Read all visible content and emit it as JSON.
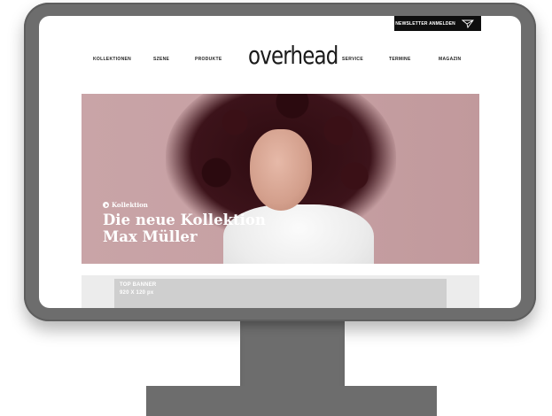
{
  "newsletter": {
    "label": "Newsletter anmelden",
    "icon": "paper-plane-icon"
  },
  "nav": {
    "left_items": [
      "Kollektionen",
      "Szene",
      "Produkte"
    ],
    "right_items": [
      "Service",
      "Termine",
      "Magazin"
    ]
  },
  "logo": {
    "text": "overhead"
  },
  "hero": {
    "tag": "Kollektion",
    "title_line1": "Die neue Kollektion",
    "title_line2": "Max Müller"
  },
  "banner": {
    "label": "TOP BANNER",
    "size": "920 X 120 px"
  },
  "colors": {
    "monitor": "#6d6d6d",
    "hero_bg": "#c6a0a3",
    "banner": "#cfcfcf",
    "newsletter_bg": "#0e0e0e"
  }
}
